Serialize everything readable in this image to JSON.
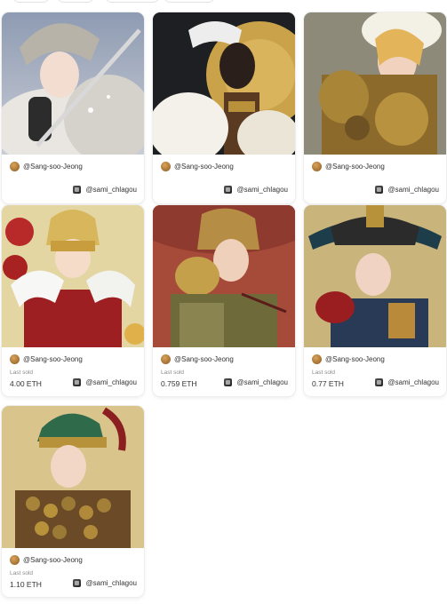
{
  "cards": [
    {
      "creator": "@Sang-soo-Jeong",
      "owner": "@sami_chlagou",
      "last_sold_label": "",
      "price": ""
    },
    {
      "creator": "@Sang-soo-Jeong",
      "owner": "@sami_chlagou",
      "last_sold_label": "",
      "price": ""
    },
    {
      "creator": "@Sang-soo-Jeong",
      "owner": "@sami_chlagou",
      "last_sold_label": "",
      "price": ""
    },
    {
      "creator": "@Sang-soo-Jeong",
      "owner": "@sami_chlagou",
      "last_sold_label": "Last sold",
      "price": "4.00 ETH"
    },
    {
      "creator": "@Sang-soo-Jeong",
      "owner": "@sami_chlagou",
      "last_sold_label": "Last sold",
      "price": "0.759 ETH"
    },
    {
      "creator": "@Sang-soo-Jeong",
      "owner": "@sami_chlagou",
      "last_sold_label": "Last sold",
      "price": "0.77 ETH"
    },
    {
      "creator": "@Sang-soo-Jeong",
      "owner": "@sami_chlagou",
      "last_sold_label": "Last sold",
      "price": "1.10 ETH"
    }
  ],
  "colors": {
    "page_background": "#ffffff",
    "card_border": "#eeeeee",
    "secondary_text": "#8a8a8a"
  },
  "icons": {
    "creator_avatar": "avatar",
    "owner_avatar": "owner-icon"
  }
}
